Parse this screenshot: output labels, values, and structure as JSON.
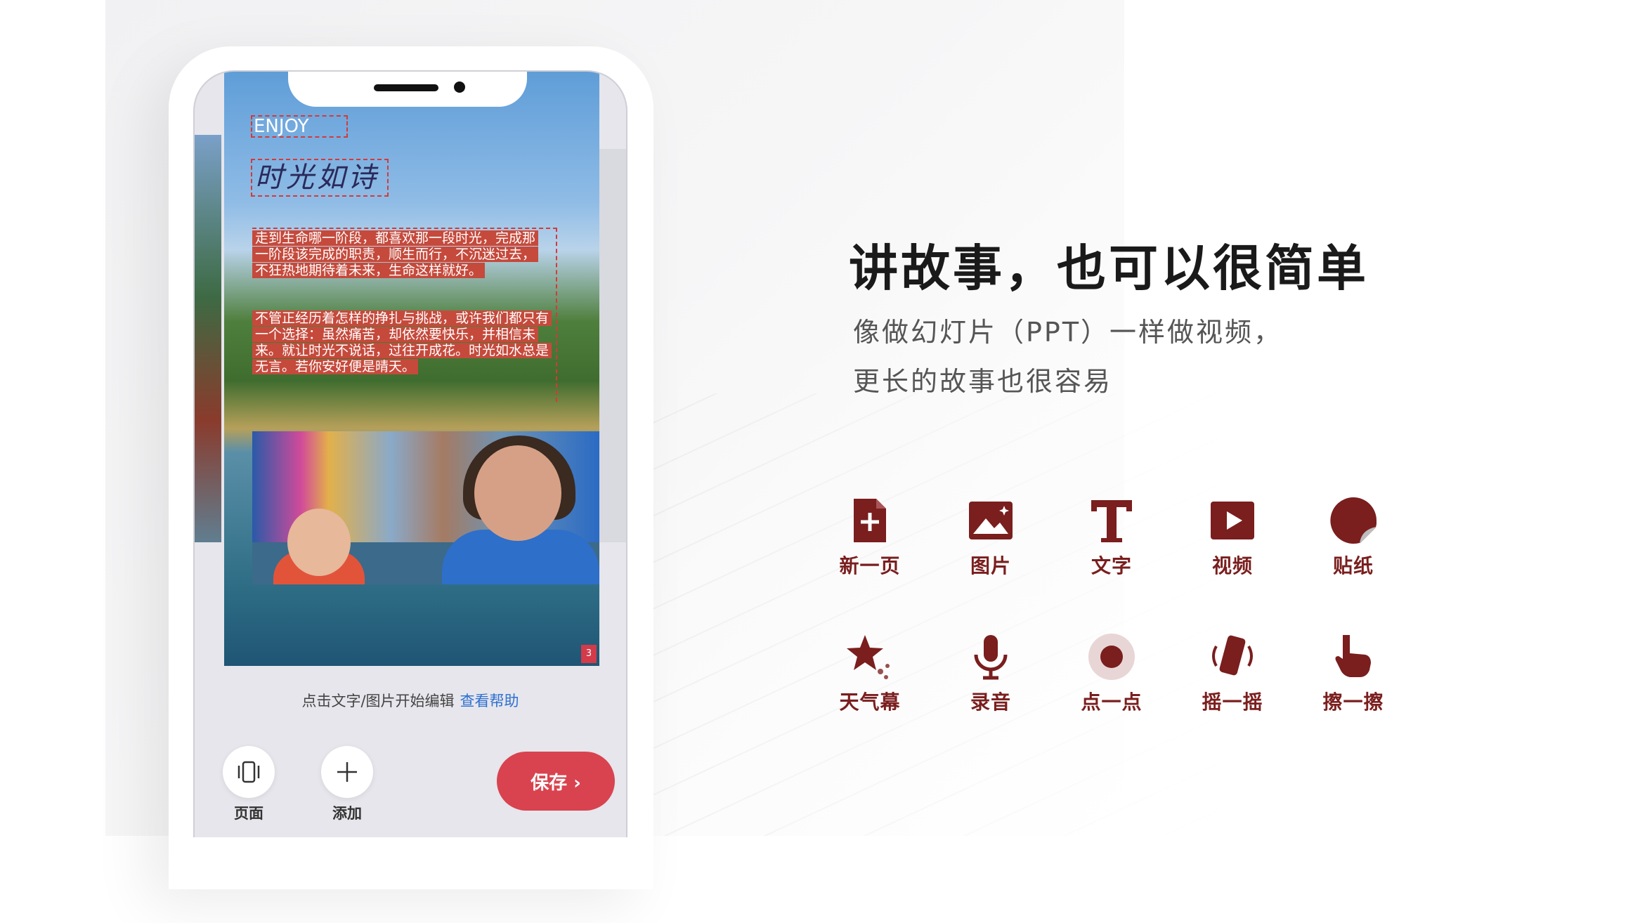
{
  "phone": {
    "slide": {
      "enjoy_text": "ENJOY",
      "handwritten_title": "时光如诗",
      "paragraph1": "走到生命哪一阶段，都喜欢那一段时光，完成那一阶段该完成的职责，顺生而行，不沉迷过去，不狂热地期待着未来，生命这样就好。",
      "paragraph2": "不管正经历着怎样的挣扎与挑战，或许我们都只有一个选择：虽然痛苦，却依然要快乐，并相信未来。就让时光不说话，过往开成花。时光如水总是无言。若你安好便是晴天。",
      "page_number": "3"
    },
    "hint_text": "点击文字/图片开始编辑",
    "help_link": "查看帮助",
    "toolbar": {
      "pages_label": "页面",
      "add_label": "添加",
      "save_label": "保存 ›"
    }
  },
  "promo": {
    "headline": "讲故事，也可以很简单",
    "subline1": "像做幻灯片（PPT）一样做视频，",
    "subline2": "更长的故事也很容易"
  },
  "features": [
    {
      "label": "新一页",
      "icon": "new-page-icon"
    },
    {
      "label": "图片",
      "icon": "image-icon"
    },
    {
      "label": "文字",
      "icon": "text-icon"
    },
    {
      "label": "视频",
      "icon": "video-icon"
    },
    {
      "label": "贴纸",
      "icon": "sticker-icon"
    },
    {
      "label": "天气幕",
      "icon": "weather-star-icon"
    },
    {
      "label": "录音",
      "icon": "microphone-icon"
    },
    {
      "label": "点一点",
      "icon": "tap-dot-icon"
    },
    {
      "label": "摇一摇",
      "icon": "shake-phone-icon"
    },
    {
      "label": "擦一擦",
      "icon": "wipe-hand-icon"
    }
  ],
  "colors": {
    "accent": "#d8434f",
    "feature_icon": "#7a1e1e",
    "link": "#2f6fd0"
  }
}
